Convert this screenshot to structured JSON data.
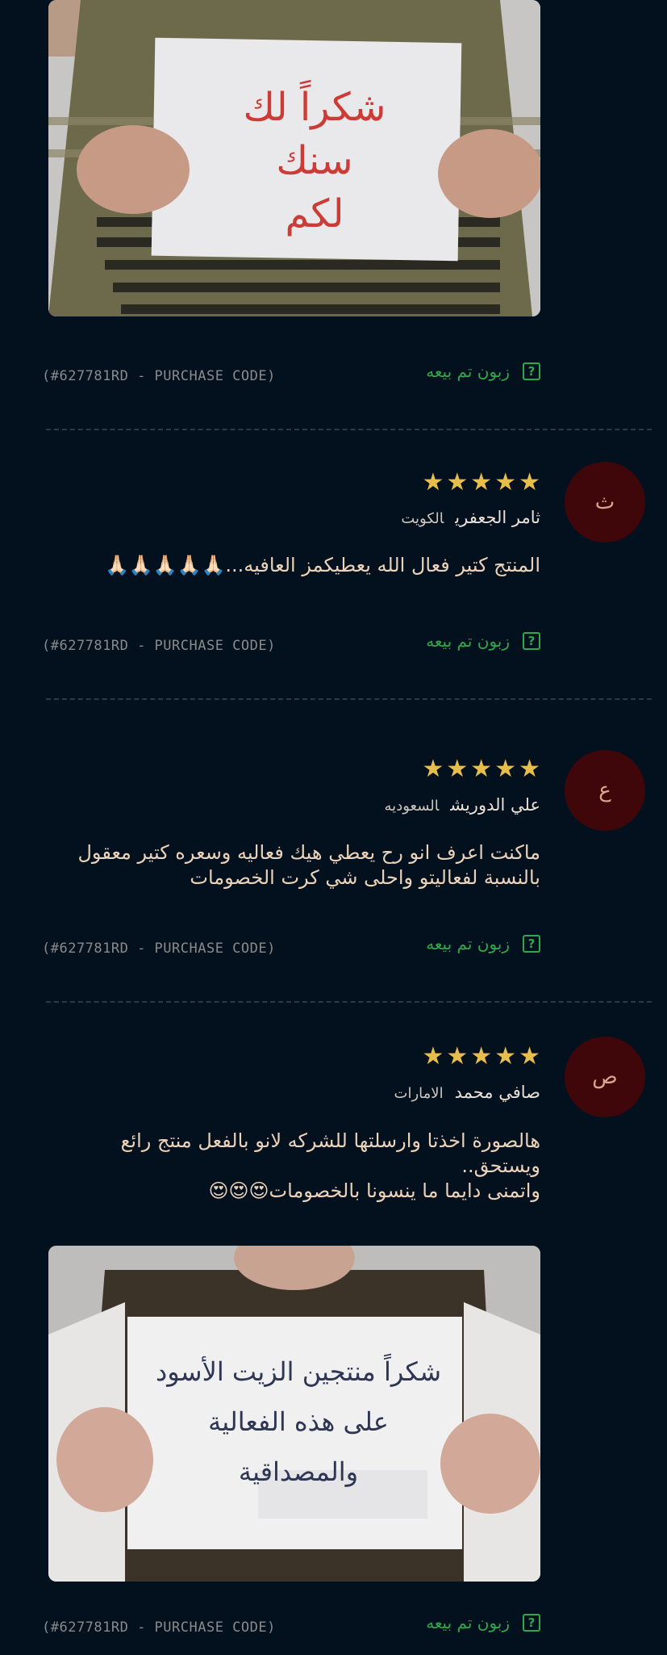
{
  "purchase_code_text": "(#627781RD - PURCHASE CODE)",
  "verified_text": "زبون تم بيعه",
  "icons": {
    "verified": "question-square-icon",
    "star": "star-icon"
  },
  "colors": {
    "background": "#03111f",
    "avatar": "#3f0709",
    "star": "#e7bd4b",
    "verified": "#2fa84a"
  },
  "top_photo": {
    "sign_lines": [
      "شكراً لك",
      "سنك",
      "لكم"
    ]
  },
  "reviews": [
    {
      "avatar_letter": "ث",
      "rating": 5,
      "author": "ثامر الجعفري",
      "country": "الكويت",
      "text": "المنتج كتير فعال الله يعطيكمز العافيه...🙏🏻🙏🏻🙏🏻🙏🏻🙏🏻"
    },
    {
      "avatar_letter": "ع",
      "rating": 5,
      "author": "علي الدوريش",
      "country": "السعوديه",
      "text": "ماكنت اعرف انو رح يعطي هيك فعاليه وسعره كتير معقول بالنسبة لفعاليتو واحلى شي كرت الخصومات"
    },
    {
      "avatar_letter": "ص",
      "rating": 5,
      "author": "صافي محمد",
      "country": "الامارات",
      "text_lines": [
        "هالصورة اخذتا وارسلتها للشركه لانو بالفعل منتج رائع ويستحق..",
        "واتمنى دايما ما ينسونا بالخصومات😍😍😍"
      ],
      "photo": {
        "sign_lines": [
          "شكراً منتجين الزيت الأسود",
          "على هذه الفعالية والمصداقية"
        ]
      }
    }
  ]
}
